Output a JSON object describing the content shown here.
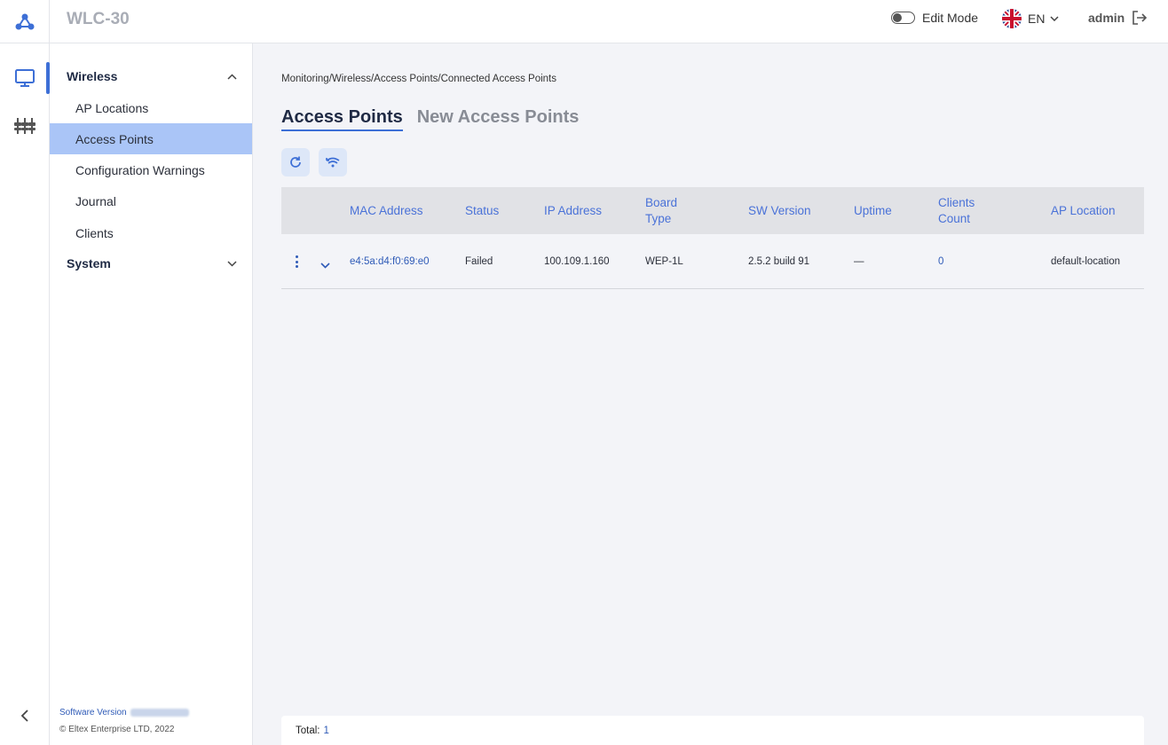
{
  "header": {
    "app_title": "WLC-30",
    "edit_mode_label": "Edit Mode",
    "edit_mode_on": false,
    "language": "EN",
    "user": "admin"
  },
  "rail": {
    "items": [
      {
        "icon": "monitor-icon",
        "active": true
      },
      {
        "icon": "sliders-icon",
        "active": false
      }
    ]
  },
  "sidebar": {
    "sections": [
      {
        "label": "Wireless",
        "expanded": true
      },
      {
        "label": "System",
        "expanded": false
      }
    ],
    "items": [
      {
        "label": "AP Locations"
      },
      {
        "label": "Access Points"
      },
      {
        "label": "Configuration Warnings"
      },
      {
        "label": "Journal"
      },
      {
        "label": "Clients"
      }
    ],
    "active_item": "Access Points",
    "software_version_label": "Software Version",
    "copyright": "© Eltex Enterprise LTD, 2022"
  },
  "main": {
    "breadcrumb": "Monitoring/Wireless/Access Points/Connected Access Points",
    "tabs": [
      {
        "label": "Access Points",
        "active": true
      },
      {
        "label": "New Access Points",
        "active": false
      }
    ],
    "table": {
      "columns": [
        {
          "l1": "MAC Address",
          "l2": ""
        },
        {
          "l1": "Status",
          "l2": ""
        },
        {
          "l1": "IP Address",
          "l2": ""
        },
        {
          "l1": "Board",
          "l2": "Type"
        },
        {
          "l1": "SW Version",
          "l2": ""
        },
        {
          "l1": "Uptime",
          "l2": ""
        },
        {
          "l1": "Clients",
          "l2": "Count"
        },
        {
          "l1": "AP Location",
          "l2": ""
        }
      ],
      "rows": [
        {
          "mac": "e4:5a:d4:f0:69:e0",
          "status": "Failed",
          "ip": "100.109.1.160",
          "board_type": "WEP-1L",
          "sw_version": "2.5.2 build 91",
          "uptime": "—",
          "clients_count": "0",
          "ap_location": "default-location"
        }
      ]
    },
    "total_label": "Total:",
    "total_value": "1"
  },
  "colors": {
    "accent": "#3d6fd6",
    "active_item_bg": "#aac5f7",
    "table_header_bg": "#e1e2e6"
  }
}
